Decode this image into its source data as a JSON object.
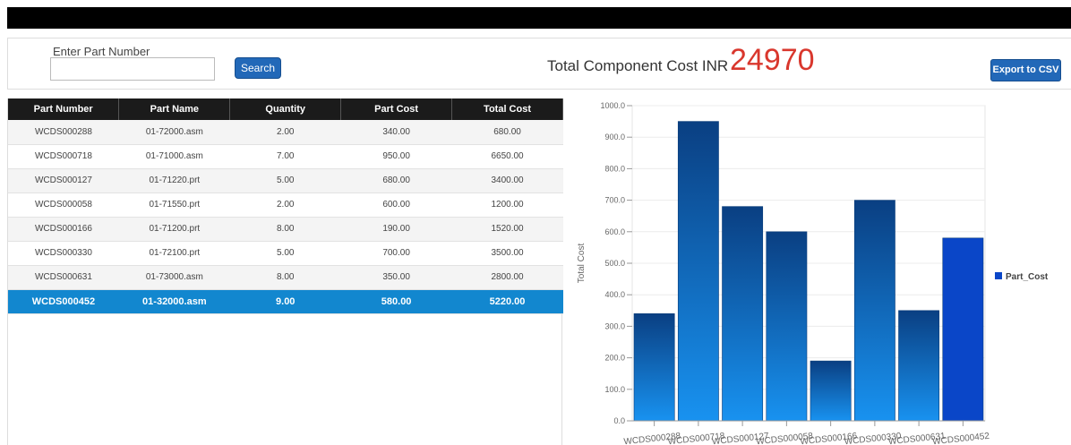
{
  "header": {
    "part_number_label": "Enter Part Number",
    "part_number_value": "",
    "search_label": "Search",
    "total_label": "Total Component Cost INR",
    "total_value": "24970",
    "export_label": "Export to CSV"
  },
  "table": {
    "columns": [
      "Part Number",
      "Part Name",
      "Quantity",
      "Part Cost",
      "Total Cost"
    ],
    "rows": [
      [
        "WCDS000288",
        "01-72000.asm",
        "2.00",
        "340.00",
        "680.00"
      ],
      [
        "WCDS000718",
        "01-71000.asm",
        "7.00",
        "950.00",
        "6650.00"
      ],
      [
        "WCDS000127",
        "01-71220.prt",
        "5.00",
        "680.00",
        "3400.00"
      ],
      [
        "WCDS000058",
        "01-71550.prt",
        "2.00",
        "600.00",
        "1200.00"
      ],
      [
        "WCDS000166",
        "01-71200.prt",
        "8.00",
        "190.00",
        "1520.00"
      ],
      [
        "WCDS000330",
        "01-72100.prt",
        "5.00",
        "700.00",
        "3500.00"
      ],
      [
        "WCDS000631",
        "01-73000.asm",
        "8.00",
        "350.00",
        "2800.00"
      ],
      [
        "WCDS000452",
        "01-32000.asm",
        "9.00",
        "580.00",
        "5220.00"
      ]
    ],
    "selected_row": 7
  },
  "chart_data": {
    "type": "bar",
    "categories": [
      "WCDS000288",
      "WCDS000718",
      "WCDS000127",
      "WCDS000058",
      "WCDS000166",
      "WCDS000330",
      "WCDS000631",
      "WCDS000452"
    ],
    "series": [
      {
        "name": "Part_Cost",
        "values": [
          340,
          950,
          680,
          600,
          190,
          700,
          350,
          580
        ]
      }
    ],
    "ylabel": "Total Cost",
    "ylim": [
      0,
      1000
    ],
    "yticks": [
      "0.0",
      "100.0",
      "200.0",
      "300.0",
      "400.0",
      "500.0",
      "600.0",
      "700.0",
      "800.0",
      "900.0",
      "1000.0"
    ],
    "legend": "right",
    "highlight_index": 7,
    "colors": {
      "bar_top": "#0a3f82",
      "bar_bottom": "#1892f0",
      "highlight": "#0a46c8"
    }
  }
}
